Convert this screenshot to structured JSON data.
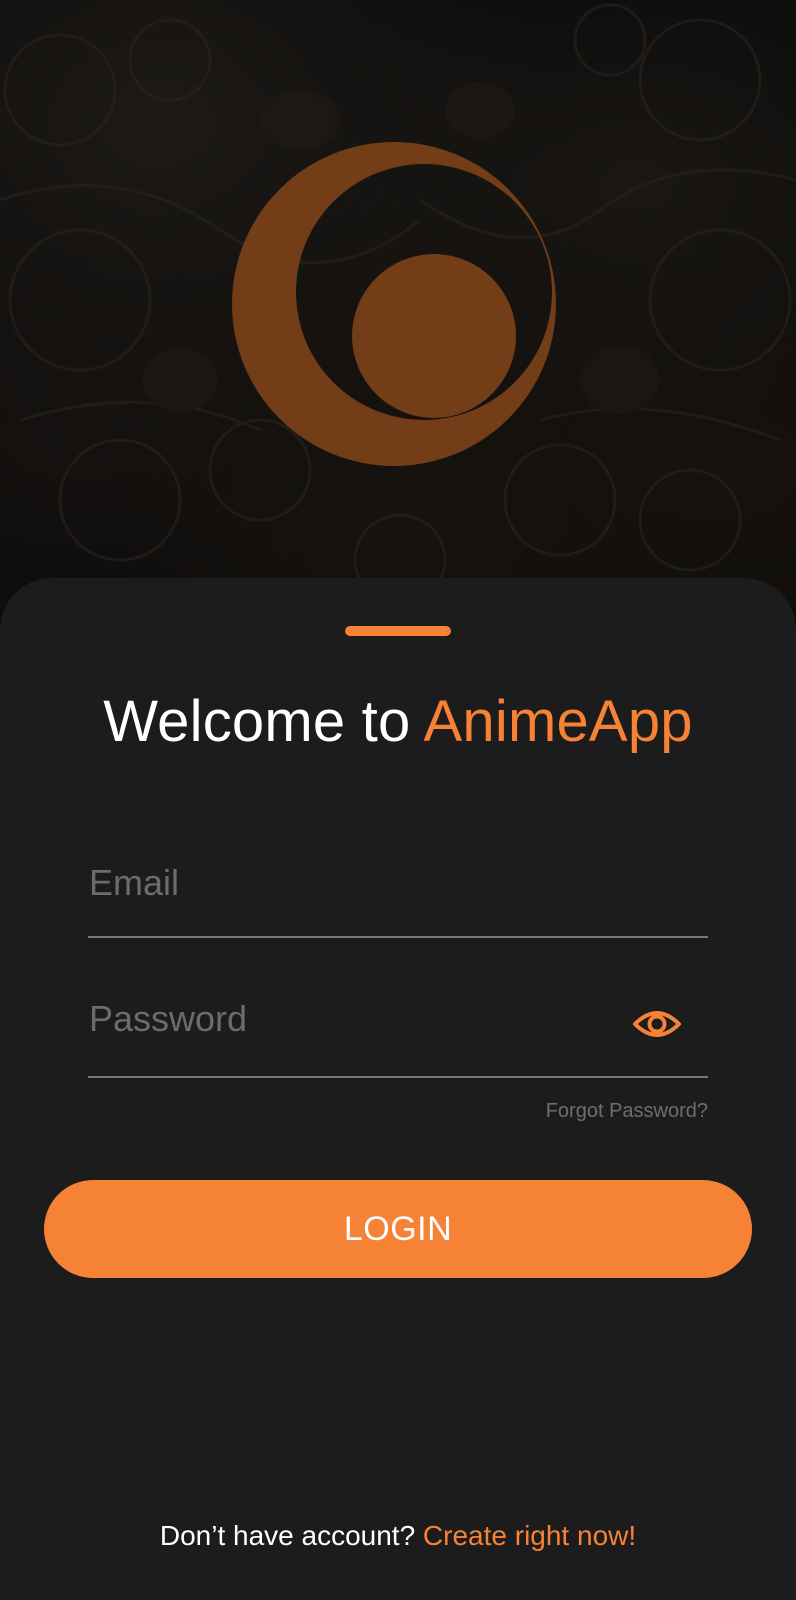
{
  "colors": {
    "accent": "#f58235",
    "logo": "#723d17",
    "sheet_bg": "#1c1c1c",
    "placeholder": "#6c6c6c",
    "underline": "#7d756f"
  },
  "hero": {
    "logo_icon": "crescent-circle-logo"
  },
  "welcome": {
    "prefix": "Welcome to ",
    "app_name": "AnimeApp"
  },
  "form": {
    "email_placeholder": "Email",
    "password_placeholder": "Password",
    "password_toggle_icon": "eye-icon",
    "forgot_password": "Forgot Password?",
    "login_label": "LOGIN"
  },
  "footer": {
    "prompt": "Don’t have account? ",
    "create_link": "Create right now!"
  }
}
